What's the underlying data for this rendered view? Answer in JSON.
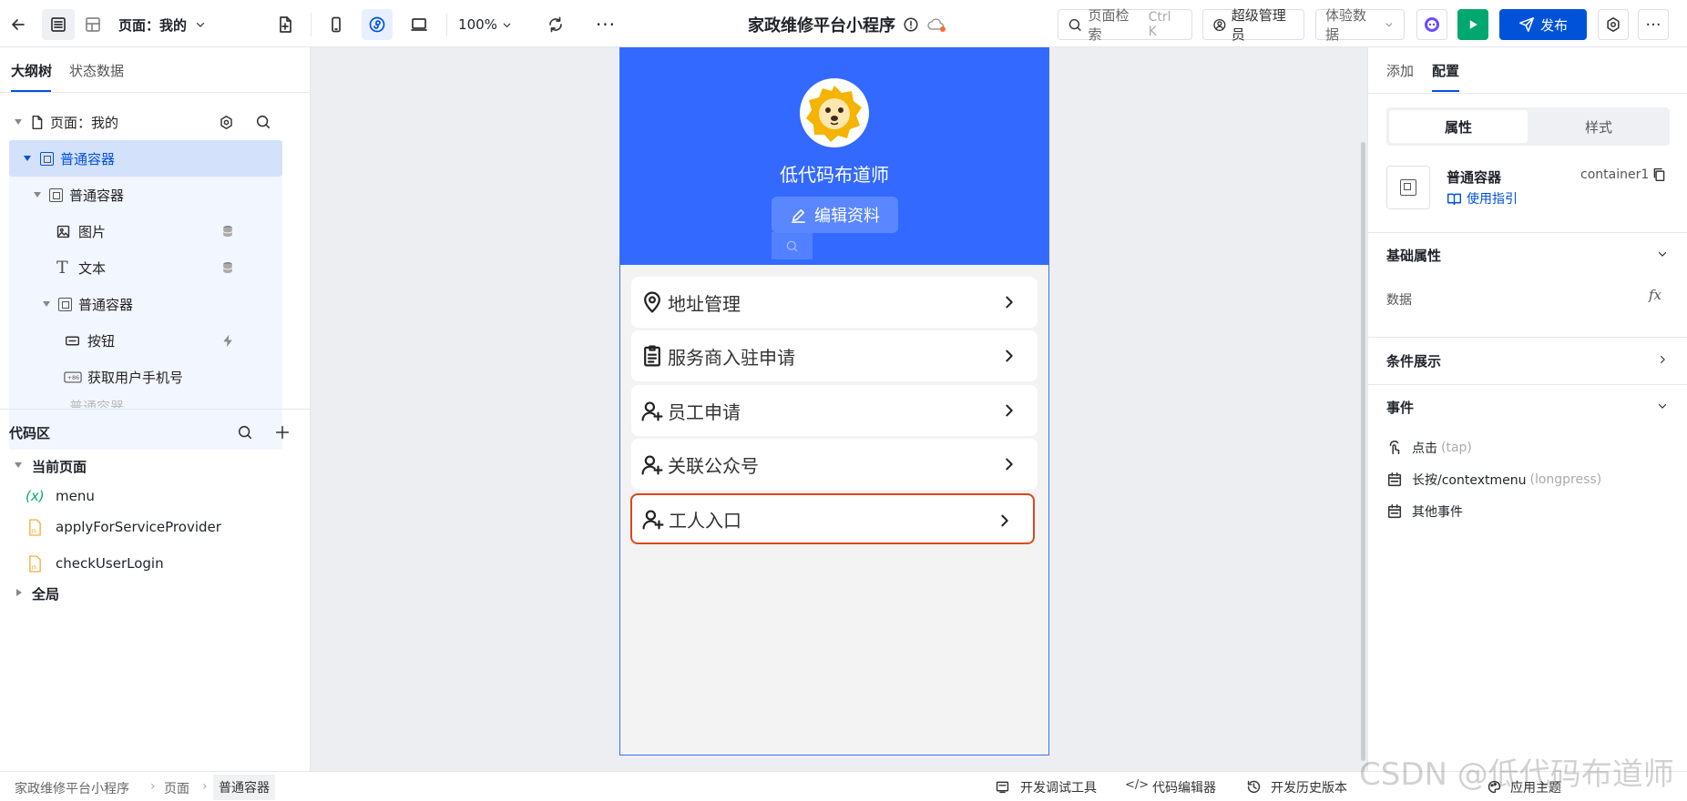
{
  "topbar": {
    "page_selector": "页面：我的",
    "zoom": "100%",
    "app_title": "家政维修平台小程序",
    "search_label": "页面检索",
    "search_shortcut": "Ctrl K",
    "role_label": "超级管理员",
    "data_mode": "体验数据",
    "publish_label": "发布",
    "colors": {
      "primary": "#0052d9",
      "run": "#00a870"
    }
  },
  "left": {
    "tabs": [
      "大纲树",
      "状态数据"
    ],
    "tree": {
      "root": "页面：我的",
      "n1": "普通容器",
      "n2": "普通容器",
      "n3": "图片",
      "n4": "文本",
      "n5": "普通容器",
      "n6": "按钮",
      "n7": "获取用户手机号",
      "n8": "普通容器"
    },
    "code": {
      "title": "代码区",
      "current_page": "当前页面",
      "items": [
        "menu",
        "applyForServiceProvider",
        "checkUserLogin"
      ],
      "global": "全局"
    }
  },
  "phone": {
    "username": "低代码布道师",
    "edit_profile": "编辑资料",
    "header_color": "#3369ff",
    "menu": [
      {
        "label": "地址管理",
        "icon": "location-pin-icon"
      },
      {
        "label": "服务商入驻申请",
        "icon": "clipboard-icon"
      },
      {
        "label": "员工申请",
        "icon": "user-add-icon"
      },
      {
        "label": "关联公众号",
        "icon": "user-add-icon"
      },
      {
        "label": "工人入口",
        "icon": "user-add-icon"
      }
    ]
  },
  "right": {
    "tabs": [
      "添加",
      "配置"
    ],
    "segment": [
      "属性",
      "样式"
    ],
    "component_name": "普通容器",
    "component_id": "container1",
    "guide_link": "使用指引",
    "basic_props": "基础属性",
    "data_label": "数据",
    "condition": "条件展示",
    "events_title": "事件",
    "events": [
      {
        "label": "点击",
        "hint": "(tap)"
      },
      {
        "label": "长按/contextmenu",
        "hint": "(longpress)"
      },
      {
        "label": "其他事件",
        "hint": ""
      }
    ]
  },
  "statusbar": {
    "breadcrumb": [
      "家政维修平台小程序",
      "页面",
      "普通容器"
    ],
    "tools": [
      "开发调试工具",
      "代码编辑器",
      "开发历史版本",
      "应用主题"
    ],
    "watermark": "CSDN @低代码布道师"
  }
}
